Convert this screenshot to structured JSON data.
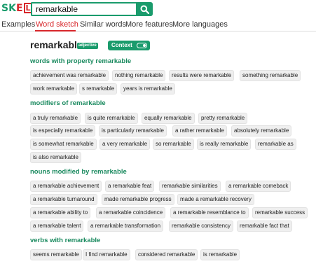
{
  "app": {
    "logo": {
      "part1": "SK",
      "part2": "E",
      "part3": "LL"
    }
  },
  "search": {
    "value": "remarkable",
    "placeholder": ""
  },
  "nav": {
    "items": [
      "Examples",
      "Word sketch",
      "Similar words",
      "More features",
      "More languages"
    ],
    "active": "Word sketch"
  },
  "headword": {
    "word": "remarkable",
    "pos": "adjective",
    "context_label": "Context",
    "context_on": true
  },
  "colors": {
    "accent": "#1a9b6c",
    "active_tab": "#d7262a",
    "section_title": "#1a8a5f",
    "chip_bg": "#efefef"
  },
  "sections": [
    {
      "title": "words with property remarkable",
      "items": [
        "achievement was remarkable",
        "nothing remarkable",
        "results were remarkable",
        "something remarkable",
        "work remarkable",
        "s remarkable",
        "years is remarkable"
      ]
    },
    {
      "title": "modifiers of remarkable",
      "items": [
        "a truly remarkable",
        "is quite remarkable",
        "equally remarkable",
        "pretty remarkable",
        "is especially remarkable",
        "is particularly remarkable",
        "a rather remarkable",
        "absolutely remarkable",
        "is somewhat remarkable",
        "a very remarkable",
        "so remarkable",
        "is really remarkable",
        "remarkable as",
        "is also remarkable"
      ]
    },
    {
      "title": "nouns modified by remarkable",
      "items": [
        "a remarkable achievement",
        "a remarkable feat",
        "remarkable similarities",
        "a remarkable comeback",
        "a remarkable turnaround",
        "made remarkable progress",
        "made a remarkable recovery",
        "a remarkable ability to",
        "a remarkable coincidence",
        "a remarkable resemblance to",
        "remarkable success",
        "a remarkable talent",
        "a remarkable transformation",
        "remarkable consistency",
        "remarkable fact that"
      ]
    },
    {
      "title": "verbs with remarkable",
      "items": [
        "seems remarkable",
        "I find remarkable",
        "considered remarkable",
        "is remarkable"
      ]
    }
  ]
}
